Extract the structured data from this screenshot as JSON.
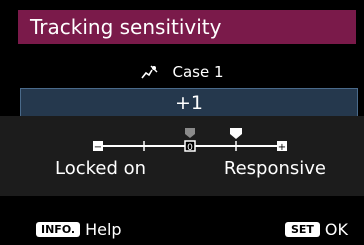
{
  "title": "Tracking sensitivity",
  "case": {
    "icon": "tracking-subject-icon",
    "label": "Case 1"
  },
  "value_display": "+1",
  "scale": {
    "min_label": "Locked on",
    "max_label": "Responsive",
    "range": [
      -2,
      2
    ],
    "default_value": 0,
    "current_value": 1,
    "minus_glyph": "−",
    "plus_glyph": "+",
    "zero_glyph": "0"
  },
  "footer": {
    "info_key": "INFO.",
    "info_label": "Help",
    "set_key": "SET",
    "set_label": "OK"
  },
  "colors": {
    "title_bg": "#7a1a4a",
    "value_bg": "#25384d",
    "default_marker": "#8a8a8a",
    "current_marker": "#ffffff"
  }
}
